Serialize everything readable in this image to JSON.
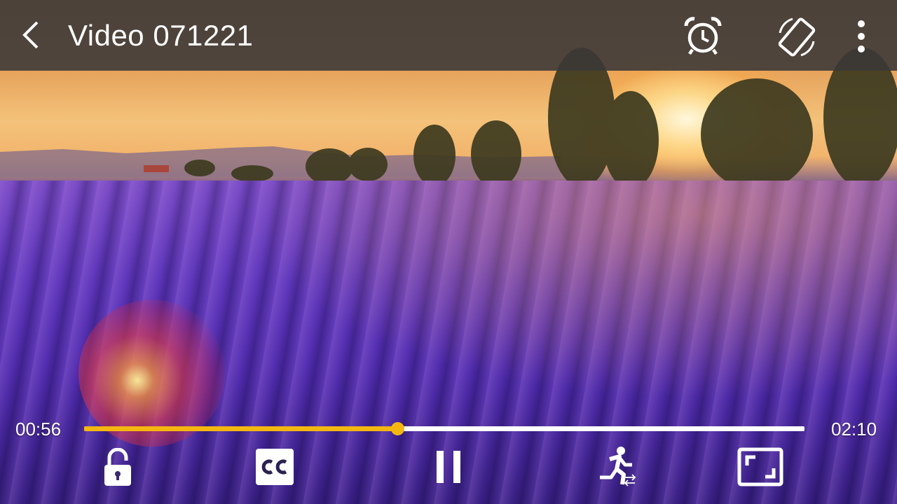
{
  "window": {
    "title": "Video 071221"
  },
  "icons": {
    "back": "back-arrow-icon",
    "alarm": "alarm-clock-icon",
    "rotate": "screen-rotation-icon",
    "more": "more-vertical-icon",
    "lock": "unlocked-padlock-icon",
    "captions": "closed-captions-icon",
    "pause": "pause-icon",
    "speed": "running-person-speed-icon",
    "fullscreen": "fullscreen-icon"
  },
  "playback": {
    "current_time": "00:56",
    "total_time": "02:10",
    "progress_fraction": 0.435
  },
  "colors": {
    "accent": "#f5b70f",
    "top_bar": "#3a3838",
    "icon": "#ffffff"
  }
}
